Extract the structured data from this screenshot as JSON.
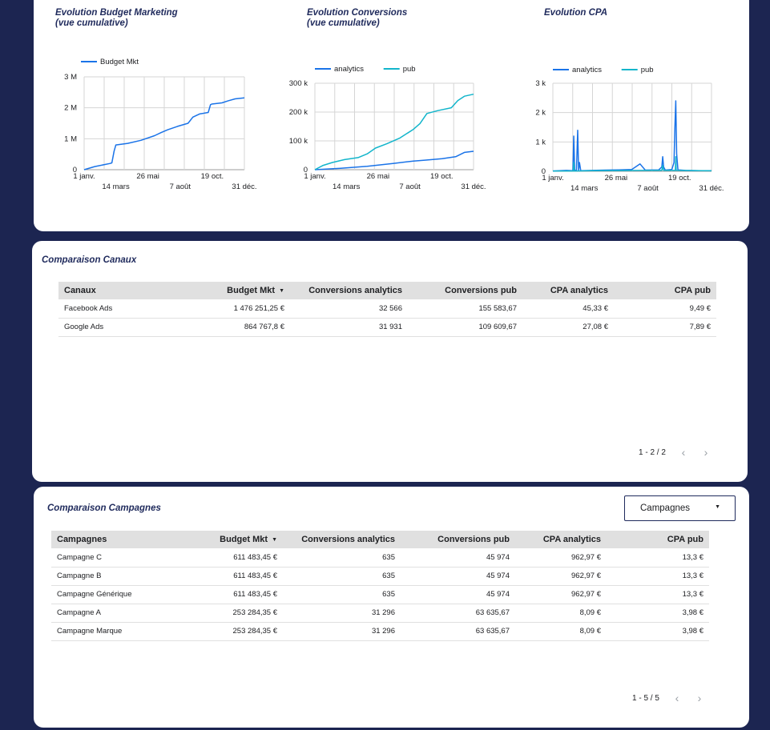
{
  "charts": [
    {
      "title_line1": "Evolution Budget Marketing",
      "title_line2": "(vue cumulative)",
      "legend": [
        {
          "label": "Budget Mkt",
          "color": "#1a73e8"
        }
      ],
      "y_ticks": [
        "0",
        "1 M",
        "2 M",
        "3 M"
      ],
      "x_ticks_top": [
        "1 janv.",
        "26 mai",
        "19 oct."
      ],
      "x_ticks_bottom": [
        "14 mars",
        "7 août",
        "31 déc."
      ]
    },
    {
      "title_line1": "Evolution Conversions",
      "title_line2": "(vue cumulative)",
      "legend": [
        {
          "label": "analytics",
          "color": "#1a73e8"
        },
        {
          "label": "pub",
          "color": "#12b5cb"
        }
      ],
      "y_ticks": [
        "0",
        "100 k",
        "200 k",
        "300 k"
      ],
      "x_ticks_top": [
        "1 janv.",
        "26 mai",
        "19 oct."
      ],
      "x_ticks_bottom": [
        "14 mars",
        "7 août",
        "31 déc."
      ]
    },
    {
      "title_line1": "Evolution CPA",
      "title_line2": "",
      "legend": [
        {
          "label": "analytics",
          "color": "#1a73e8"
        },
        {
          "label": "pub",
          "color": "#12b5cb"
        }
      ],
      "y_ticks": [
        "0",
        "1 k",
        "2 k",
        "3 k"
      ],
      "x_ticks_top": [
        "1 janv.",
        "26 mai",
        "19 oct."
      ],
      "x_ticks_bottom": [
        "14 mars",
        "7 août",
        "31 déc."
      ]
    }
  ],
  "chart_data": [
    {
      "type": "line",
      "title": "Evolution Budget Marketing (vue cumulative)",
      "ylim": [
        0,
        3000000
      ],
      "xlim": [
        "2021-01-01",
        "2021-12-31"
      ],
      "series": [
        {
          "name": "Budget Mkt",
          "color": "#1a73e8",
          "x": [
            "2021-01-01",
            "2021-01-25",
            "2021-02-28",
            "2021-03-05",
            "2021-03-10",
            "2021-03-14",
            "2021-04-10",
            "2021-05-10",
            "2021-06-10",
            "2021-06-25",
            "2021-07-10",
            "2021-08-01",
            "2021-08-25",
            "2021-09-05",
            "2021-09-20",
            "2021-10-10",
            "2021-10-15",
            "2021-10-18",
            "2021-11-10",
            "2021-11-25",
            "2021-12-10",
            "2021-12-31"
          ],
          "values": [
            0,
            100000,
            200000,
            220000,
            600000,
            800000,
            850000,
            950000,
            1100000,
            1200000,
            1290000,
            1400000,
            1500000,
            1700000,
            1800000,
            1850000,
            2100000,
            2120000,
            2160000,
            2230000,
            2290000,
            2320000
          ]
        }
      ]
    },
    {
      "type": "line",
      "title": "Evolution Conversions (vue cumulative)",
      "ylim": [
        0,
        300000
      ],
      "xlim": [
        "2021-01-01",
        "2021-12-31"
      ],
      "series": [
        {
          "name": "analytics",
          "color": "#1a73e8",
          "x": [
            "2021-01-01",
            "2021-03-01",
            "2021-05-01",
            "2021-07-01",
            "2021-08-15",
            "2021-09-10",
            "2021-10-20",
            "2021-11-20",
            "2021-12-10",
            "2021-12-31"
          ],
          "values": [
            0,
            5000,
            12000,
            22000,
            30000,
            33000,
            38000,
            45000,
            60000,
            64000
          ]
        },
        {
          "name": "pub",
          "color": "#12b5cb",
          "x": [
            "2021-01-01",
            "2021-01-20",
            "2021-02-10",
            "2021-03-10",
            "2021-04-10",
            "2021-05-01",
            "2021-05-20",
            "2021-06-15",
            "2021-07-15",
            "2021-08-15",
            "2021-08-30",
            "2021-09-15",
            "2021-10-10",
            "2021-11-10",
            "2021-11-25",
            "2021-12-10",
            "2021-12-31"
          ],
          "values": [
            0,
            15000,
            25000,
            35000,
            42000,
            55000,
            75000,
            90000,
            110000,
            140000,
            160000,
            195000,
            205000,
            215000,
            240000,
            255000,
            262000
          ]
        }
      ]
    },
    {
      "type": "line",
      "title": "Evolution CPA",
      "ylim": [
        0,
        3000
      ],
      "xlim": [
        "2021-01-01",
        "2021-12-31"
      ],
      "series": [
        {
          "name": "analytics",
          "color": "#1a73e8",
          "x": [
            "2021-01-01",
            "2021-02-01",
            "2021-02-16",
            "2021-02-18",
            "2021-02-20",
            "2021-02-24",
            "2021-02-27",
            "2021-03-01",
            "2021-03-03",
            "2021-03-06",
            "2021-04-01",
            "2021-05-01",
            "2021-06-01",
            "2021-07-01",
            "2021-07-20",
            "2021-08-01",
            "2021-09-01",
            "2021-09-08",
            "2021-09-10",
            "2021-09-12",
            "2021-09-16",
            "2021-10-01",
            "2021-10-06",
            "2021-10-08",
            "2021-10-10",
            "2021-10-12",
            "2021-10-15",
            "2021-11-01",
            "2021-12-01",
            "2021-12-31"
          ],
          "values": [
            10,
            30,
            20,
            1200,
            40,
            20,
            1400,
            30,
            300,
            20,
            30,
            40,
            50,
            60,
            250,
            40,
            50,
            150,
            500,
            150,
            40,
            60,
            300,
            1500,
            2400,
            600,
            50,
            30,
            20,
            20
          ]
        },
        {
          "name": "pub",
          "color": "#12b5cb",
          "x": [
            "2021-01-01",
            "2021-02-17",
            "2021-02-18",
            "2021-02-19",
            "2021-04-01",
            "2021-06-01",
            "2021-08-01",
            "2021-09-08",
            "2021-09-10",
            "2021-09-12",
            "2021-10-09",
            "2021-10-10",
            "2021-10-11",
            "2021-12-31"
          ],
          "values": [
            10,
            10,
            300,
            10,
            20,
            25,
            30,
            30,
            200,
            30,
            30,
            500,
            30,
            15
          ]
        }
      ]
    }
  ],
  "canaux": {
    "title": "Comparaison Canaux",
    "columns": [
      "Canaux",
      "Budget Mkt",
      "Conversions analytics",
      "Conversions pub",
      "CPA analytics",
      "CPA pub"
    ],
    "sort_indicator": "▼",
    "rows": [
      [
        "Facebook Ads",
        "1 476 251,25 €",
        "32 566",
        "155 583,67",
        "45,33 €",
        "9,49 €"
      ],
      [
        "Google Ads",
        "864 767,8 €",
        "31 931",
        "109 609,67",
        "27,08 €",
        "7,89 €"
      ]
    ],
    "pagination": "1 - 2 / 2",
    "prev": "‹",
    "next": "›"
  },
  "campagnes": {
    "title": "Comparaison Campagnes",
    "dropdown_label": "Campagnes",
    "dropdown_caret": "▼",
    "columns": [
      "Campagnes",
      "Budget Mkt",
      "Conversions analytics",
      "Conversions pub",
      "CPA analytics",
      "CPA pub"
    ],
    "sort_indicator": "▼",
    "rows": [
      [
        "Campagne C",
        "611 483,45 €",
        "635",
        "45 974",
        "962,97 €",
        "13,3 €"
      ],
      [
        "Campagne B",
        "611 483,45 €",
        "635",
        "45 974",
        "962,97 €",
        "13,3 €"
      ],
      [
        "Campagne Générique",
        "611 483,45 €",
        "635",
        "45 974",
        "962,97 €",
        "13,3 €"
      ],
      [
        "Campagne A",
        "253 284,35 €",
        "31 296",
        "63 635,67",
        "8,09 €",
        "3,98 €"
      ],
      [
        "Campagne Marque",
        "253 284,35 €",
        "31 296",
        "63 635,67",
        "8,09 €",
        "3,98 €"
      ]
    ],
    "pagination": "1 - 5 / 5",
    "prev": "‹",
    "next": "›"
  }
}
